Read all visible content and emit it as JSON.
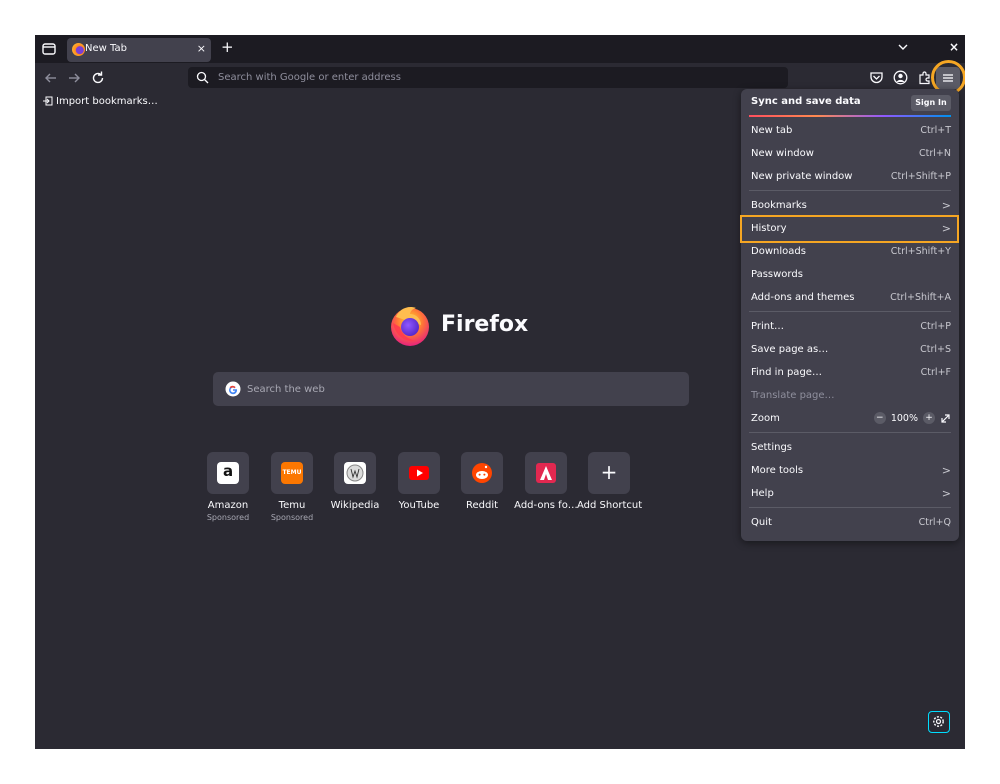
{
  "tab": {
    "title": "New Tab",
    "close": "×"
  },
  "newtab_label": "+",
  "window_close": "×",
  "urlbar": {
    "placeholder": "Search with Google or enter address"
  },
  "bookmarks": {
    "import_label": "Import bookmarks…"
  },
  "brand": {
    "wordmark": "Firefox"
  },
  "search": {
    "placeholder": "Search the web"
  },
  "top_sites": [
    {
      "name": "Amazon",
      "sponsored": "Sponsored"
    },
    {
      "name": "Temu",
      "sponsored": "Sponsored"
    },
    {
      "name": "Wikipedia",
      "sponsored": ""
    },
    {
      "name": "YouTube",
      "sponsored": ""
    },
    {
      "name": "Reddit",
      "sponsored": ""
    },
    {
      "name": "Add-ons fo…",
      "sponsored": ""
    },
    {
      "name": "Add Shortcut",
      "sponsored": ""
    }
  ],
  "tile_glyphs": {
    "add": "+",
    "amazon": "a",
    "temu": "TEMU"
  },
  "menu": {
    "sync_label": "Sync and save data",
    "signin_label": "Sign In",
    "items": {
      "new_tab": {
        "label": "New tab",
        "shortcut": "Ctrl+T"
      },
      "new_window": {
        "label": "New window",
        "shortcut": "Ctrl+N"
      },
      "new_private": {
        "label": "New private window",
        "shortcut": "Ctrl+Shift+P"
      },
      "bookmarks": {
        "label": "Bookmarks",
        "shortcut": ">"
      },
      "history": {
        "label": "History",
        "shortcut": ">"
      },
      "downloads": {
        "label": "Downloads",
        "shortcut": "Ctrl+Shift+Y"
      },
      "passwords": {
        "label": "Passwords",
        "shortcut": ""
      },
      "addons": {
        "label": "Add-ons and themes",
        "shortcut": "Ctrl+Shift+A"
      },
      "print": {
        "label": "Print…",
        "shortcut": "Ctrl+P"
      },
      "save_page": {
        "label": "Save page as…",
        "shortcut": "Ctrl+S"
      },
      "find": {
        "label": "Find in page…",
        "shortcut": "Ctrl+F"
      },
      "translate": {
        "label": "Translate page…",
        "shortcut": ""
      },
      "zoom": {
        "label": "Zoom",
        "value": "100%",
        "minus": "−",
        "plus": "+"
      },
      "settings": {
        "label": "Settings",
        "shortcut": ""
      },
      "more_tools": {
        "label": "More tools",
        "shortcut": ">"
      },
      "help": {
        "label": "Help",
        "shortcut": ">"
      },
      "quit": {
        "label": "Quit",
        "shortcut": "Ctrl+Q"
      }
    }
  },
  "colors": {
    "chrome_bg": "#1c1b22",
    "content_bg": "#2b2a33",
    "panel_bg": "#42414d",
    "highlight": "#f5a623",
    "accent": "#00ddff"
  }
}
